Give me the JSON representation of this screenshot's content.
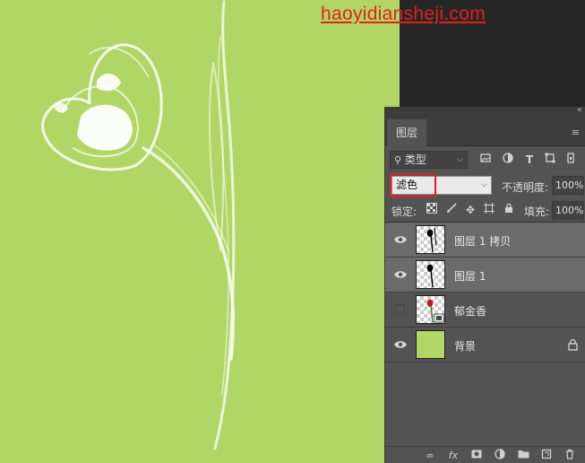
{
  "watermark": "haoyidiansheji.com",
  "colors": {
    "canvas": "#b1d665",
    "panel": "#535353",
    "selected_row": "#6b6b6b",
    "highlight": "#e2201c"
  },
  "panel": {
    "tab": "图层",
    "filter": {
      "label": "类型",
      "icon": "search-icon"
    },
    "filter_icons": [
      "image-filter-icon",
      "adjustment-filter-icon",
      "type-filter-icon",
      "shape-filter-icon",
      "smart-object-filter-icon"
    ],
    "blend_mode": "滤色",
    "opacity_label": "不透明度:",
    "opacity": "100%",
    "lock_label": "锁定:",
    "lock_icons": [
      "lock-transparent-icon",
      "lock-paint-icon",
      "lock-position-icon",
      "lock-artboard-icon",
      "lock-all-icon"
    ],
    "fill_label": "填充:",
    "fill": "100%",
    "layers": [
      {
        "name": "图层 1 拷贝",
        "visible": true,
        "selected": true
      },
      {
        "name": "图层 1",
        "visible": true,
        "selected": true
      },
      {
        "name": "郁金香",
        "visible": false,
        "selected": false,
        "smart_object": true
      },
      {
        "name": "背景",
        "visible": true,
        "selected": false,
        "locked": true
      }
    ],
    "bottom_icons": [
      "link-icon",
      "fx-icon",
      "mask-icon",
      "adjustment-icon",
      "folder-icon",
      "new-layer-icon",
      "trash-icon"
    ]
  }
}
